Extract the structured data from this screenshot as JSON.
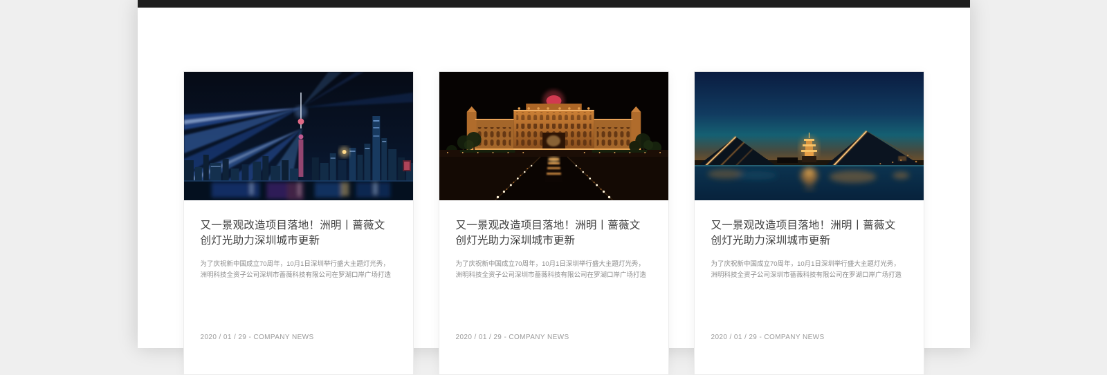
{
  "colors": {
    "page_background": "#efefef",
    "topbar": "#1e1e1e",
    "card_title": "#3e3e3e",
    "card_excerpt": "#8d8d8d",
    "card_meta": "#9a9a9a"
  },
  "news": {
    "cards": [
      {
        "image_alt": "shanghai-skyline-blue-laser-light-show",
        "title_line1": "又一景观改造项目落地！洲明丨蔷薇文",
        "title_line2": "创灯光助力深圳城市更新",
        "excerpt_line1": "为了庆祝新中国成立70周年，10月1日深圳举行盛大主题灯光秀，",
        "excerpt_line2": "洲明科技全资子公司深圳市蔷薇科技有限公司在罗湖口岸广场打造",
        "date": "2020 / 01 / 29",
        "separator": "-",
        "category": "COMPANY NEWS"
      },
      {
        "image_alt": "palace-night-golden-illumination-walkway",
        "title_line1": "又一景观改造项目落地！洲明丨蔷薇文",
        "title_line2": "创灯光助力深圳城市更新",
        "excerpt_line1": "为了庆祝新中国成立70周年，10月1日深圳举行盛大主题灯光秀，",
        "excerpt_line2": "洲明科技全资子公司深圳市蔷薇科技有限公司在罗湖口岸广场打造",
        "date": "2020 / 01 / 29",
        "separator": "-",
        "category": "COMPANY NEWS"
      },
      {
        "image_alt": "lakeside-pyramids-pagoda-dusk-lighting",
        "title_line1": "又一景观改造项目落地！洲明丨蔷薇文",
        "title_line2": "创灯光助力深圳城市更新",
        "excerpt_line1": "为了庆祝新中国成立70周年，10月1日深圳举行盛大主题灯光秀，",
        "excerpt_line2": "洲明科技全资子公司深圳市蔷薇科技有限公司在罗湖口岸广场打造",
        "date": "2020 / 01 / 29",
        "separator": "-",
        "category": "COMPANY NEWS"
      }
    ]
  }
}
